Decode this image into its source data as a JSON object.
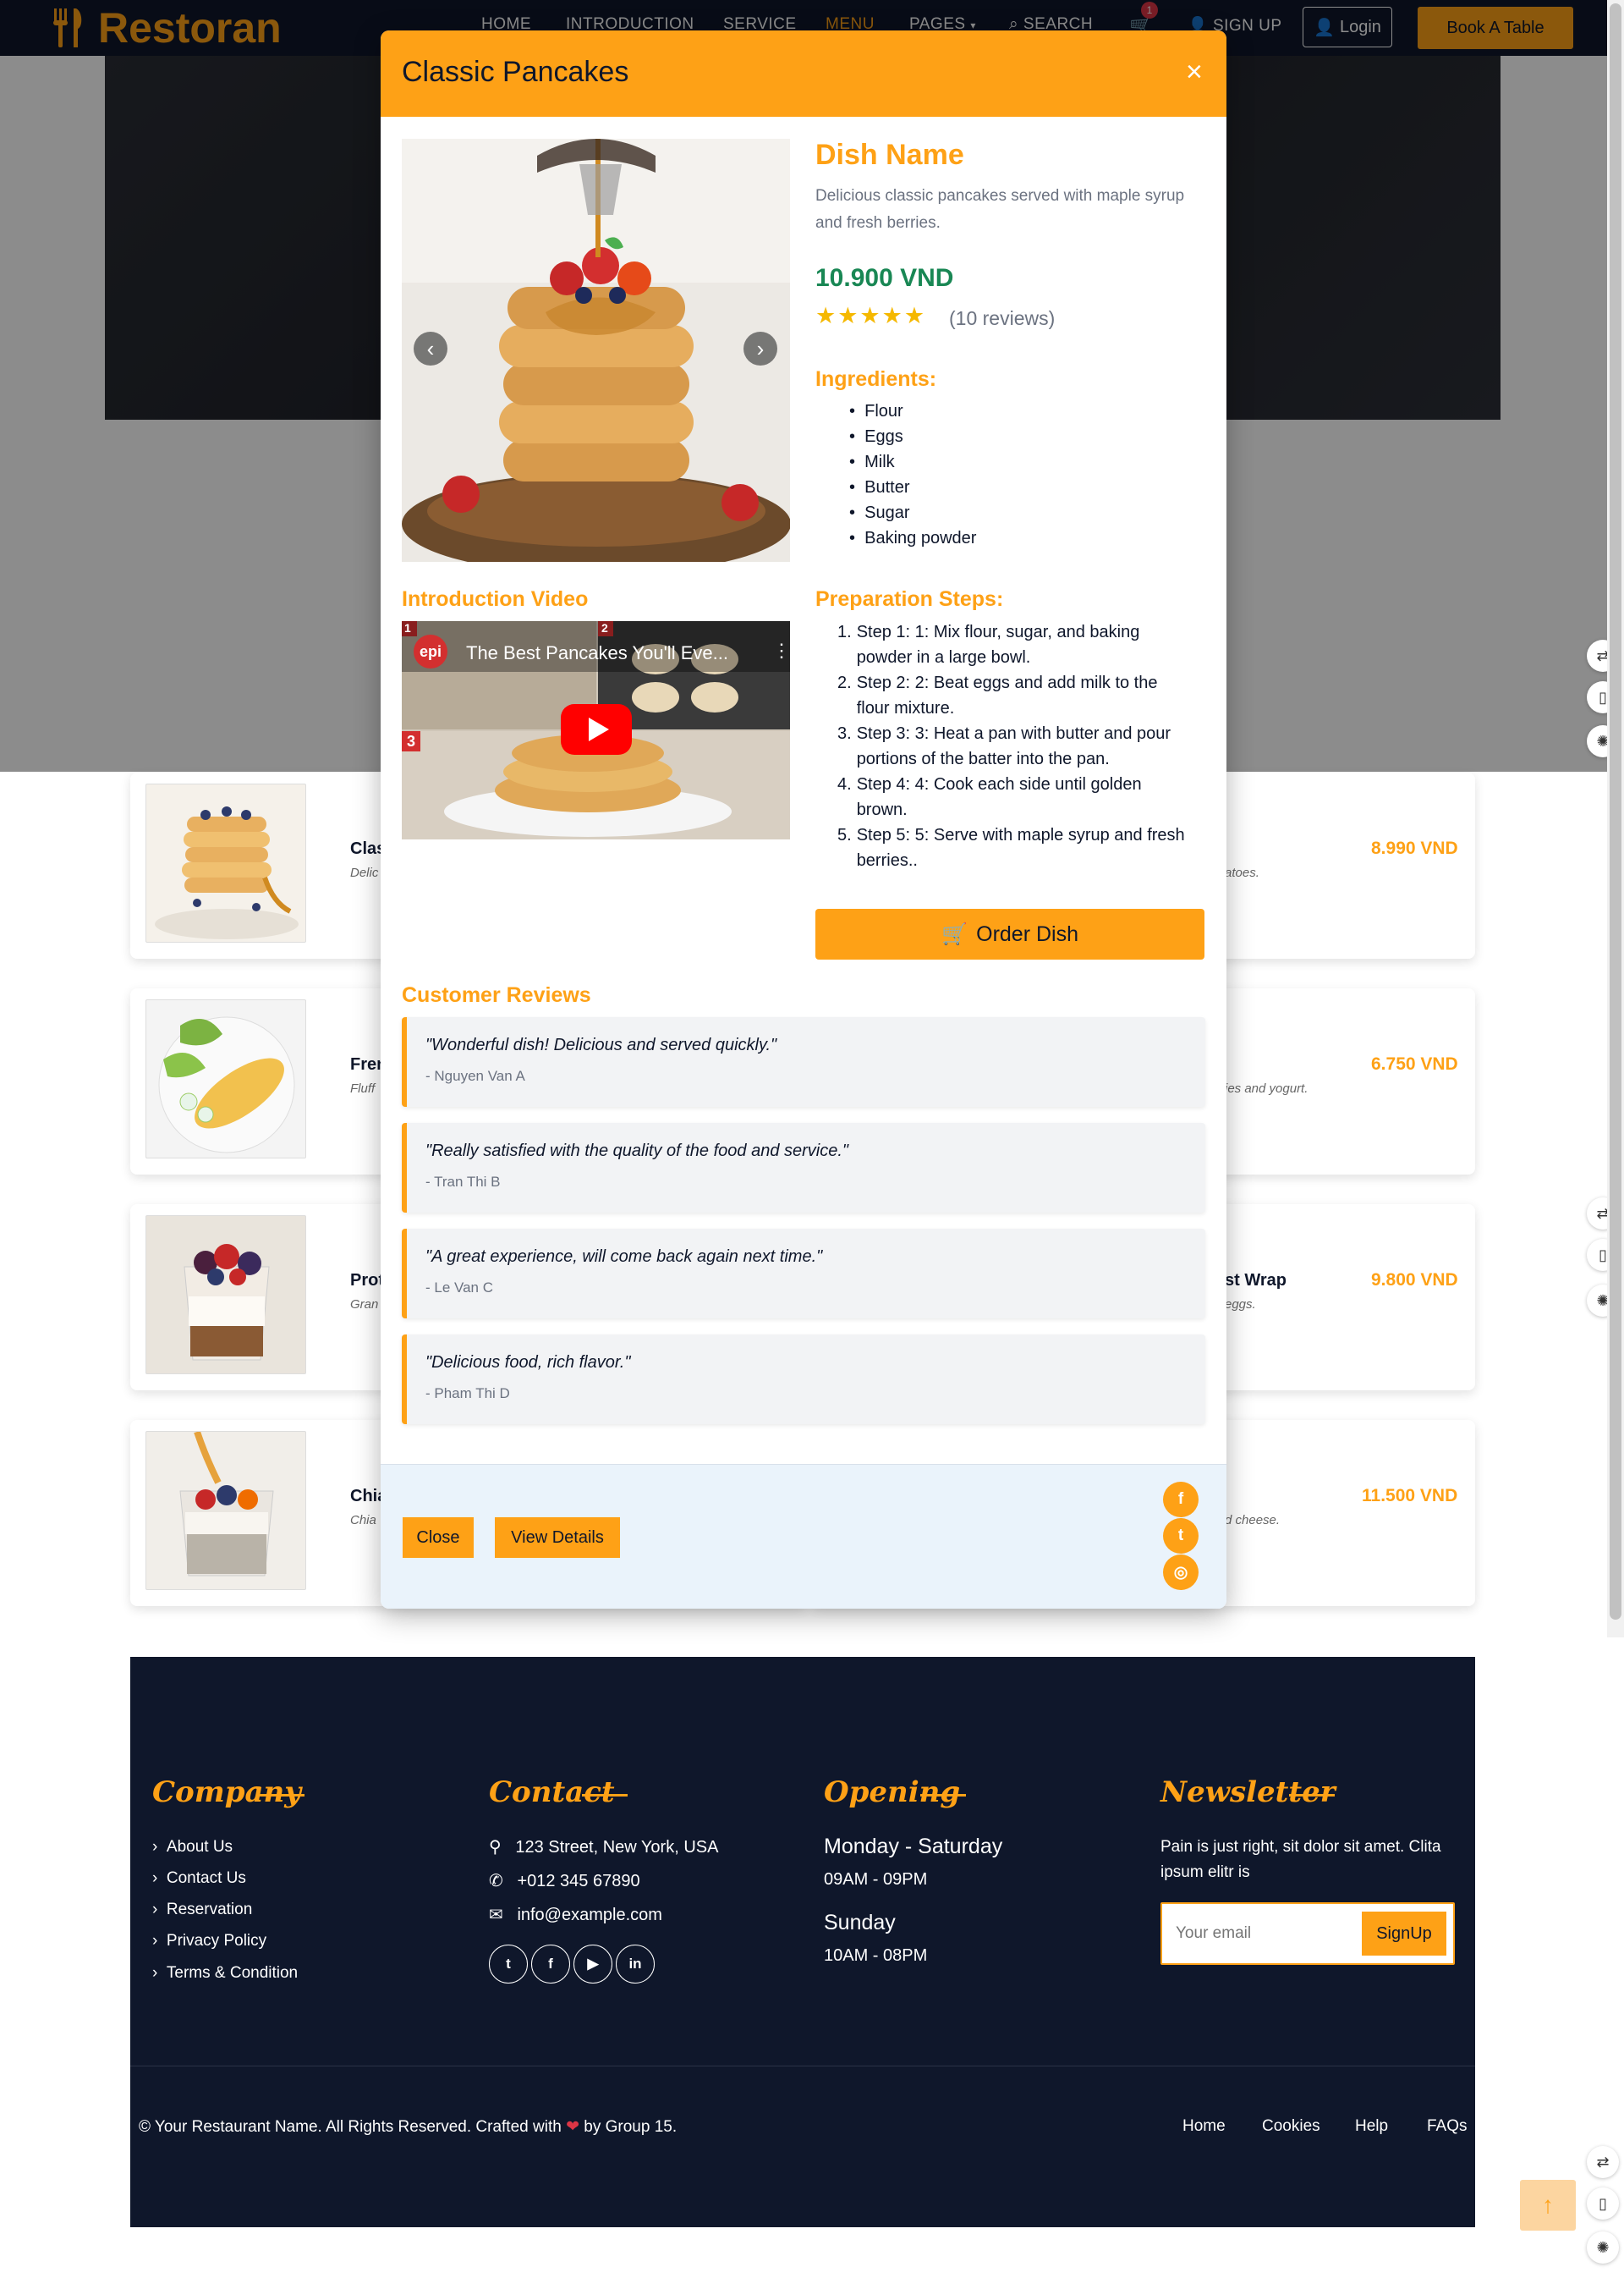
{
  "nav": {
    "brand": "Restoran",
    "links": [
      "HOME",
      "INTRODUCTION",
      "SERVICE",
      "MENU",
      "PAGES",
      "SEARCH",
      "SIGN UP"
    ],
    "cart_count": "1",
    "login": "Login",
    "book": "Book A Table"
  },
  "menu": {
    "items": [
      {
        "name": "Clas",
        "desc": "Delic",
        "price": "8.990 VND",
        "right_desc": "atoes."
      },
      {
        "name": "Fren",
        "desc": "Fluff",
        "price": "6.750 VND",
        "right_desc": "ies and yogurt."
      },
      {
        "name": "Prot",
        "desc": "Gran",
        "price": "9.800 VND",
        "right_desc": "eggs.",
        "right_name": "st Wrap"
      },
      {
        "name": "Chia",
        "desc": "Chia",
        "price": "11.500 VND",
        "right_desc": "d cheese."
      }
    ]
  },
  "modal": {
    "title": "Classic Pancakes",
    "close": "×",
    "dish_name": "Dish Name",
    "description": "Delicious classic pancakes served with maple syrup and fresh berries.",
    "price": "10.900 VND",
    "rating": 5,
    "reviews_count": "(10 reviews)",
    "ingredients_title": "Ingredients:",
    "ingredients": [
      "Flour",
      "Eggs",
      "Milk",
      "Butter",
      "Sugar",
      "Baking powder"
    ],
    "video_title": "Introduction Video",
    "video_label": "The Best Pancakes You'll Eve...",
    "video_channel": "epi",
    "steps_title": "Preparation Steps:",
    "steps": [
      "Step 1: 1: Mix flour, sugar, and baking powder in a large bowl.",
      "Step 2: 2: Beat eggs and add milk to the flour mixture.",
      "Step 3: 3: Heat a pan with butter and pour portions of the batter into the pan.",
      "Step 4: 4: Cook each side until golden brown.",
      "Step 5: 5: Serve with maple syrup and fresh berries.."
    ],
    "order_button": "Order Dish",
    "reviews_title": "Customer Reviews",
    "reviews": [
      {
        "text": "\"Wonderful dish! Delicious and served quickly.\"",
        "author": "- Nguyen Van A"
      },
      {
        "text": "\"Really satisfied with the quality of the food and service.\"",
        "author": "- Tran Thi B"
      },
      {
        "text": "\"A great experience, will come back again next time.\"",
        "author": "- Le Van C"
      },
      {
        "text": "\"Delicious food, rich flavor.\"",
        "author": "- Pham Thi D"
      }
    ],
    "close_button": "Close",
    "details_button": "View Details",
    "social": [
      "facebook-icon",
      "twitter-icon",
      "instagram-icon"
    ]
  },
  "footer": {
    "company_title": "Company",
    "company_links": [
      "About Us",
      "Contact Us",
      "Reservation",
      "Privacy Policy",
      "Terms & Condition"
    ],
    "contact_title": "Contact",
    "address": "123 Street, New York, USA",
    "phone": "+012 345 67890",
    "email": "info@example.com",
    "opening_title": "Opening",
    "days1": "Monday - Saturday",
    "hours1": "09AM - 09PM",
    "days2": "Sunday",
    "hours2": "10AM - 08PM",
    "newsletter_title": "Newsletter",
    "newsletter_text": "Pain is just right, sit dolor sit amet. Clita ipsum elitr is",
    "email_placeholder": "Your email",
    "signup": "SignUp",
    "copyright_pre": "© Your Restaurant Name. All Rights Reserved. Crafted with",
    "copyright_post": "by Group 15.",
    "bottom_links": [
      "Home",
      "Cookies",
      "Help",
      "FAQs"
    ]
  },
  "colors": {
    "accent": "#fea116",
    "dark": "#0f172b",
    "price_green": "#198754"
  }
}
